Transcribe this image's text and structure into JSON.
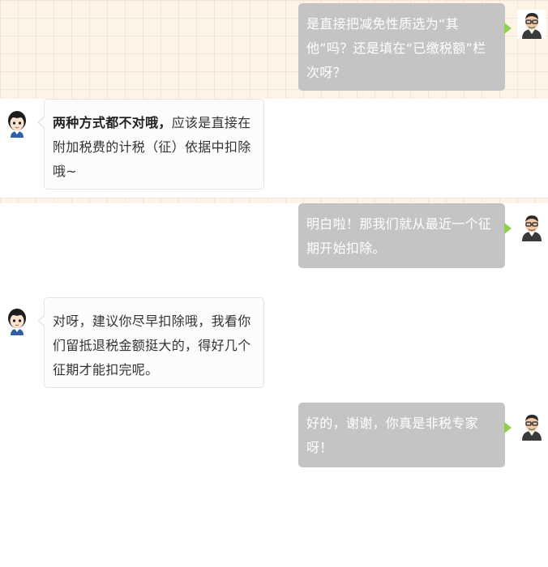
{
  "messages": [
    {
      "side": "right",
      "text": "是直接把减免性质选为“其他”吗？还是填在“已缴税额”栏次呀？"
    },
    {
      "side": "left",
      "bold": "两种方式都不对哦，",
      "text": "应该是直接在附加税费的计税（征）依据中扣除哦~"
    },
    {
      "side": "right",
      "text": "明白啦！那我们就从最近一个征期开始扣除。"
    },
    {
      "side": "left",
      "text": "对呀，建议你尽早扣除哦，我看你们留抵退税金额挺大的，得好几个征期才能扣完呢。"
    },
    {
      "side": "right",
      "text": "好的，谢谢，你真是非税专家呀！"
    }
  ],
  "colors": {
    "user_bubble": "#c4c4c4",
    "user_tail": "#8fd24a",
    "agent_bubble": "#fcfcfc",
    "band": "#fdf3e7"
  },
  "icons": {
    "user_avatar": "man-with-glasses-avatar-icon",
    "agent_avatar": "girl-cartoon-avatar-icon"
  }
}
